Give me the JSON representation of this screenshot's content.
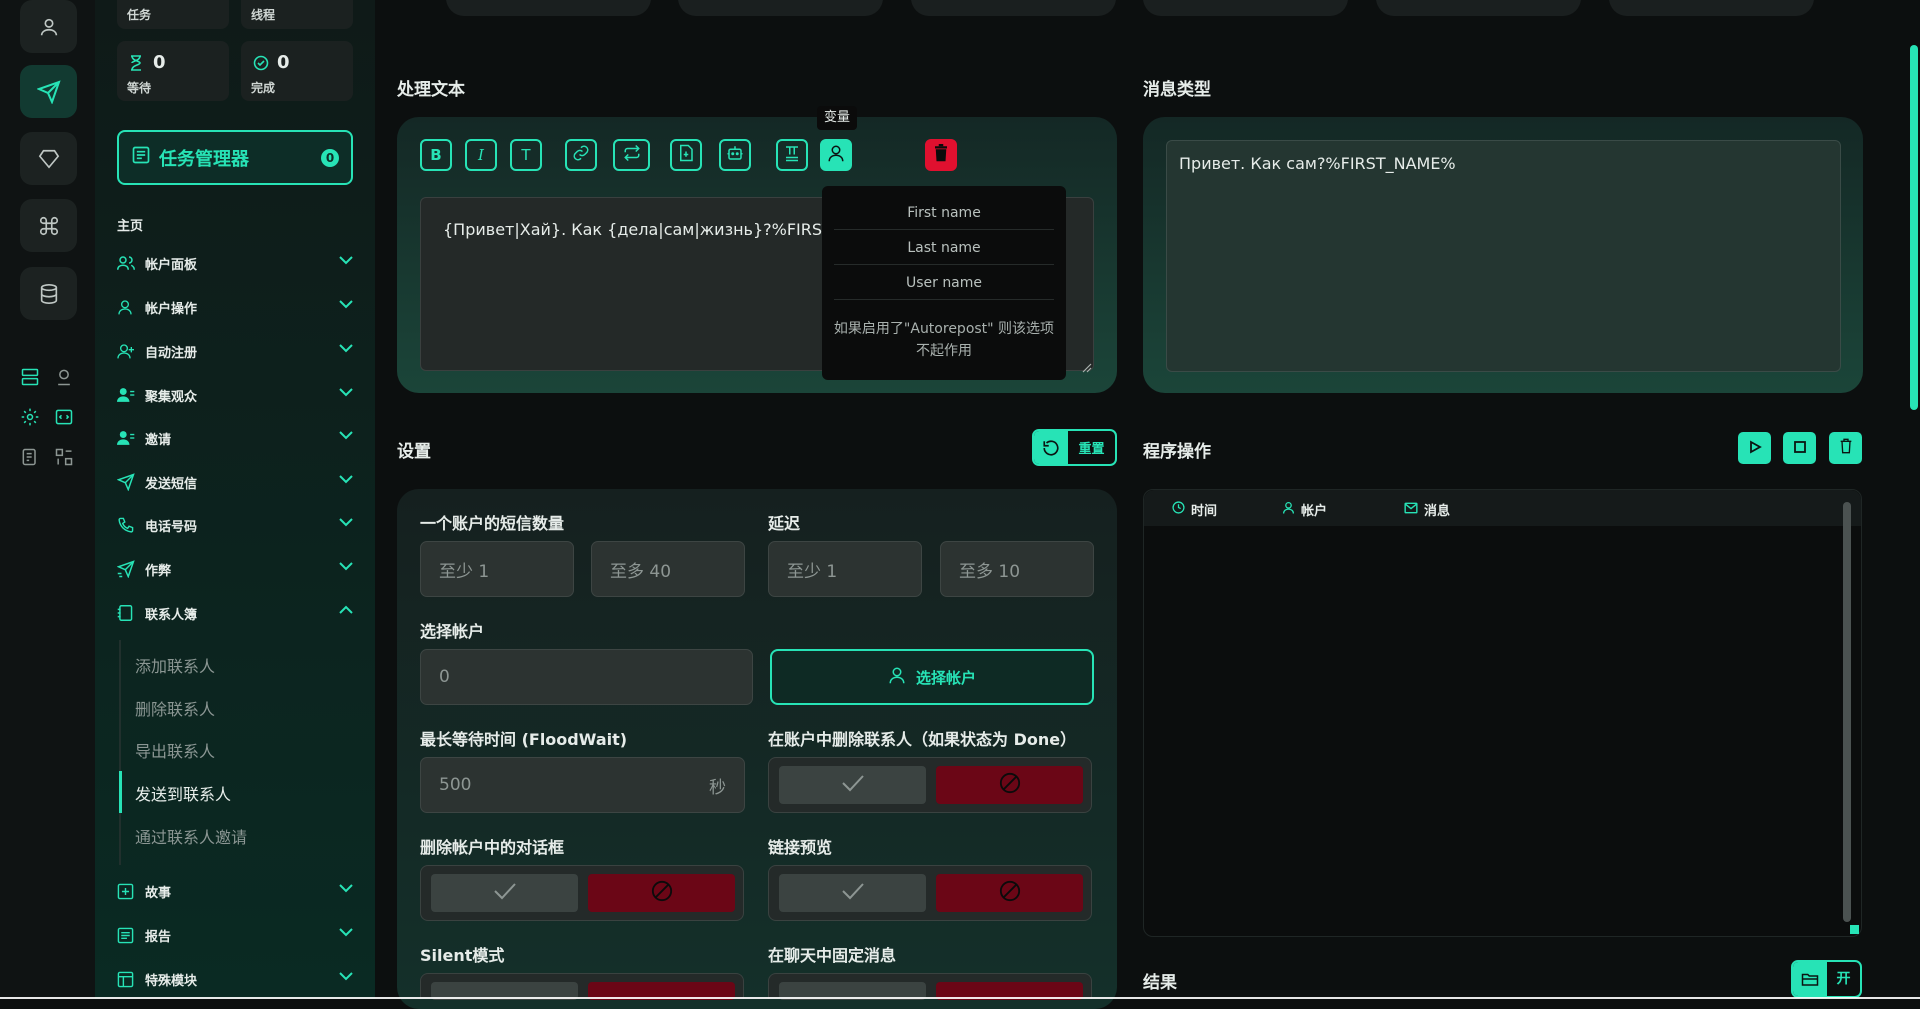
{
  "sidebar": {
    "stats": {
      "tasks_label": "任务",
      "threads_label": "线程",
      "waiting_value": "0",
      "waiting_label": "等待",
      "done_value": "0",
      "done_label": "完成"
    },
    "task_manager": {
      "label": "任务管理器",
      "badge": "0"
    },
    "home_label": "主页",
    "nav": [
      {
        "label": "帐户面板",
        "icon": "users-icon"
      },
      {
        "label": "帐户操作",
        "icon": "user-icon"
      },
      {
        "label": "自动注册",
        "icon": "user-plus-icon"
      },
      {
        "label": "聚集观众",
        "icon": "users-filled-icon"
      },
      {
        "label": "邀请",
        "icon": "users-filled-icon"
      },
      {
        "label": "发送短信",
        "icon": "send-icon"
      },
      {
        "label": "电话号码",
        "icon": "phone-icon"
      },
      {
        "label": "作弊",
        "icon": "send-boost-icon"
      },
      {
        "label": "联系人簿",
        "icon": "contacts-icon"
      }
    ],
    "contacts_sub": [
      "添加联系人",
      "删除联系人",
      "导出联系人",
      "发送到联系人",
      "通过联系人邀请"
    ],
    "nav_bottom": [
      {
        "label": "故事",
        "icon": "plus-square-icon"
      },
      {
        "label": "报告",
        "icon": "report-icon"
      },
      {
        "label": "特殊模块",
        "icon": "module-icon"
      }
    ]
  },
  "main": {
    "text_title": "处理文本",
    "message_type_title": "消息类型",
    "tooltip": "变量",
    "editor_text": "{Привет|Хай}. Как {дела|сам|жизнь}?%FIRST_N",
    "variables": [
      "First name",
      "Last name",
      "User name"
    ],
    "variables_note": "如果启用了\"Autorepost\" 则该选项不起作用",
    "preview_text": "Привет. Как сам?%FIRST_NAME%",
    "settings_title": "设置",
    "reset_label": "重置",
    "program_ops_title": "程序操作",
    "sms_per_account_label": "一个账户的短信数量",
    "delay_label": "延迟",
    "min_placeholder_1": "至少  1",
    "max_placeholder_1": "至多  40",
    "min_placeholder_2": "至少  1",
    "max_placeholder_2": "至多  10",
    "select_account_label": "选择帐户",
    "account_count": "0",
    "select_account_button": "选择帐户",
    "floodwait_label": "最长等待时间 (FloodWait)",
    "floodwait_value": "500",
    "floodwait_unit": "秒",
    "delete_contacts_label": "在账户中删除联系人（如果状态为 Done）",
    "delete_dialogs_label": "删除帐户中的对话框",
    "link_preview_label": "链接预览",
    "silent_label": "Silent模式",
    "pin_label": "在聊天中固定消息",
    "log_headers": [
      "时间",
      "帐户",
      "消息"
    ],
    "result_title": "结果",
    "open_label": "开"
  },
  "colors": {
    "accent": "#27e3b6",
    "danger": "#e0102f",
    "toggle_off": "#6b0616"
  }
}
